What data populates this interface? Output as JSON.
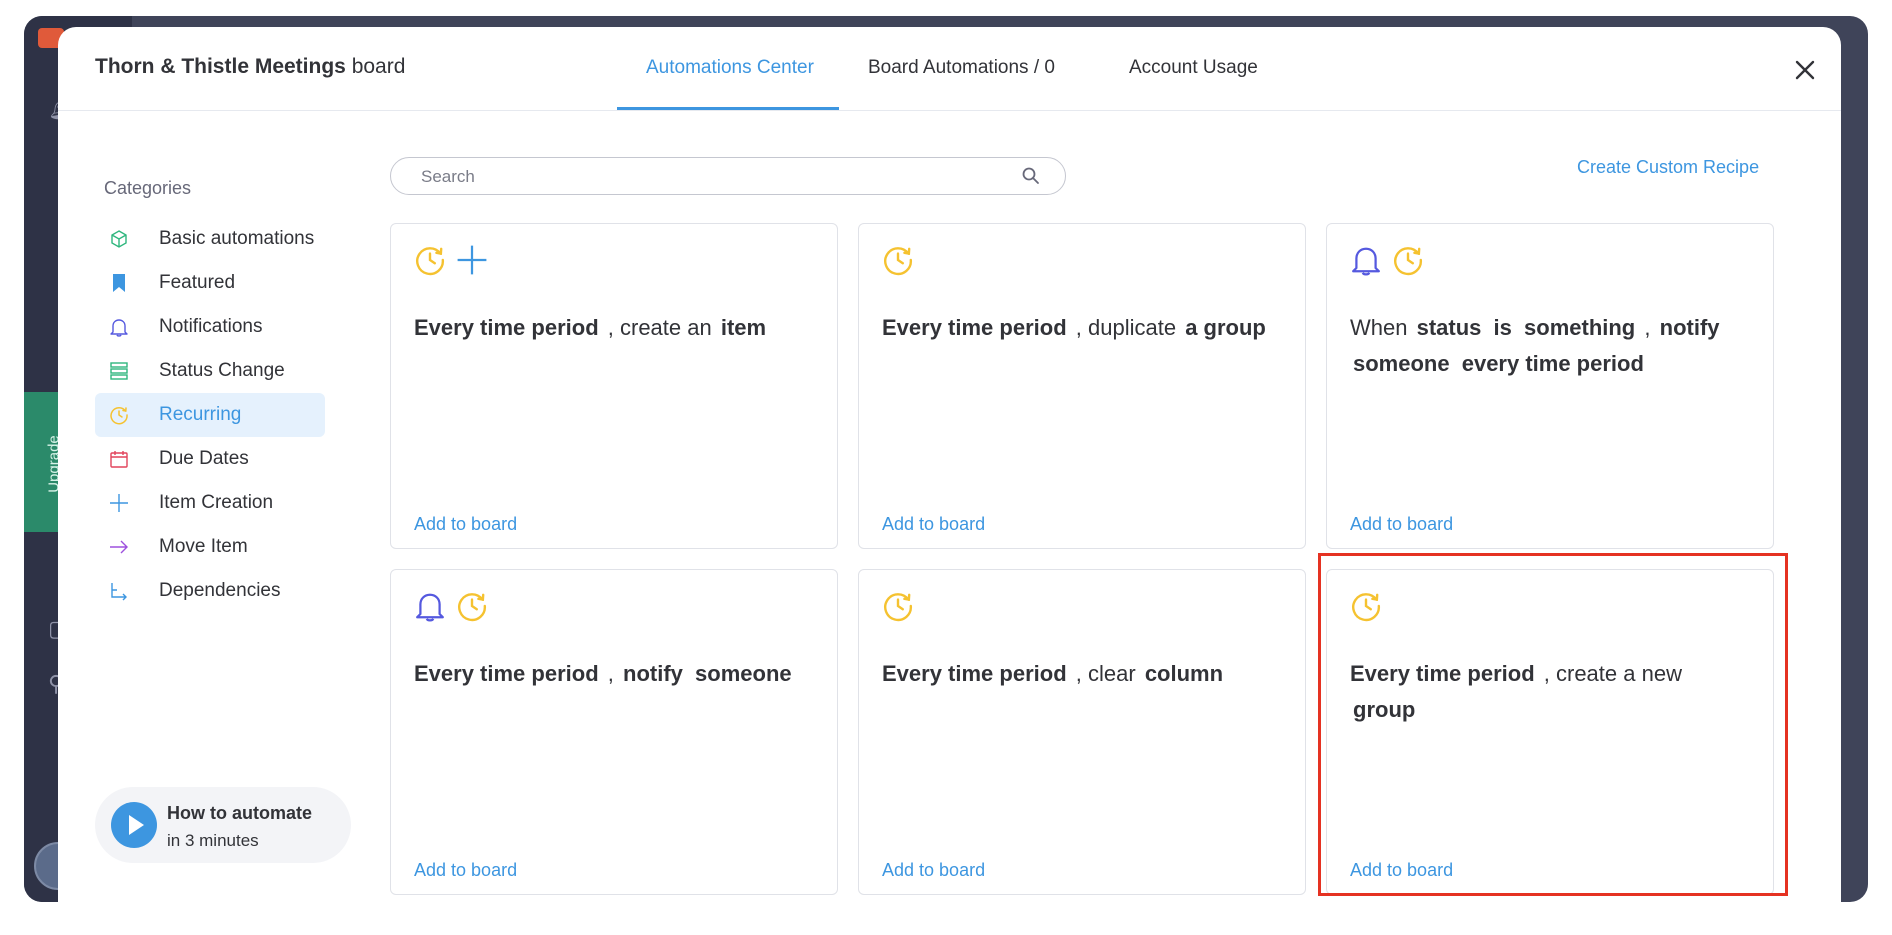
{
  "background": {
    "upgrade_label": "Upgrade"
  },
  "header": {
    "board_name": "Thorn & Thistle Meetings",
    "board_suffix": "board",
    "tabs": [
      {
        "label": "Automations Center",
        "active": true
      },
      {
        "label": "Board Automations / 0",
        "active": false
      },
      {
        "label": "Account Usage",
        "active": false
      }
    ]
  },
  "sidebar": {
    "heading": "Categories",
    "items": [
      {
        "label": "Basic automations",
        "icon": "cube-icon",
        "color": "#2eb67d"
      },
      {
        "label": "Featured",
        "icon": "bookmark-icon",
        "color": "#3d96e0"
      },
      {
        "label": "Notifications",
        "icon": "bell-icon",
        "color": "#5559df"
      },
      {
        "label": "Status Change",
        "icon": "list-icon",
        "color": "#2eb67d"
      },
      {
        "label": "Recurring",
        "icon": "clock-icon",
        "color": "#f5c230",
        "selected": true
      },
      {
        "label": "Due Dates",
        "icon": "calendar-icon",
        "color": "#e2445c"
      },
      {
        "label": "Item Creation",
        "icon": "plus-icon",
        "color": "#3d96e0"
      },
      {
        "label": "Move Item",
        "icon": "arrow-right-icon",
        "color": "#9d50dd"
      },
      {
        "label": "Dependencies",
        "icon": "dependency-icon",
        "color": "#3d96e0"
      }
    ],
    "howto": {
      "title": "How to automate",
      "subtitle": "in 3 minutes"
    }
  },
  "search": {
    "placeholder": "Search",
    "value": ""
  },
  "create_custom_label": "Create Custom Recipe",
  "cards": [
    {
      "icons": [
        "clock-icon",
        "plus-icon"
      ],
      "parts": [
        {
          "t": "Every time period",
          "b": true
        },
        {
          "t": ", create an",
          "b": false
        },
        {
          "t": "item",
          "b": true
        }
      ],
      "add_label": "Add to board"
    },
    {
      "icons": [
        "clock-icon"
      ],
      "parts": [
        {
          "t": "Every time period",
          "b": true
        },
        {
          "t": ", duplicate",
          "b": false
        },
        {
          "t": "a group",
          "b": true
        }
      ],
      "add_label": "Add to board"
    },
    {
      "icons": [
        "bell-icon",
        "clock-icon"
      ],
      "parts": [
        {
          "t": "When",
          "b": false
        },
        {
          "t": "status",
          "b": true
        },
        {
          "t": "is",
          "b": true
        },
        {
          "t": "something",
          "b": true
        },
        {
          "t": ",",
          "b": false
        },
        {
          "t": "notify",
          "b": true
        },
        {
          "t": "someone",
          "b": true
        },
        {
          "t": "every time period",
          "b": true
        }
      ],
      "add_label": "Add to board"
    },
    {
      "icons": [
        "bell-icon",
        "clock-icon"
      ],
      "parts": [
        {
          "t": "Every time period",
          "b": true
        },
        {
          "t": ",",
          "b": false
        },
        {
          "t": "notify",
          "b": true
        },
        {
          "t": "someone",
          "b": true
        }
      ],
      "add_label": "Add to board"
    },
    {
      "icons": [
        "clock-icon"
      ],
      "parts": [
        {
          "t": "Every time period",
          "b": true
        },
        {
          "t": ", clear",
          "b": false
        },
        {
          "t": "column",
          "b": true
        }
      ],
      "add_label": "Add to board"
    },
    {
      "icons": [
        "clock-icon"
      ],
      "parts": [
        {
          "t": "Every time period",
          "b": true
        },
        {
          "t": ", create a new",
          "b": false
        },
        {
          "t": "group",
          "b": true
        }
      ],
      "add_label": "Add to board",
      "highlighted": true
    }
  ],
  "colors": {
    "accent": "#3d96e0",
    "highlight": "#e53222",
    "recurring": "#f5c230",
    "bell": "#5559df"
  }
}
